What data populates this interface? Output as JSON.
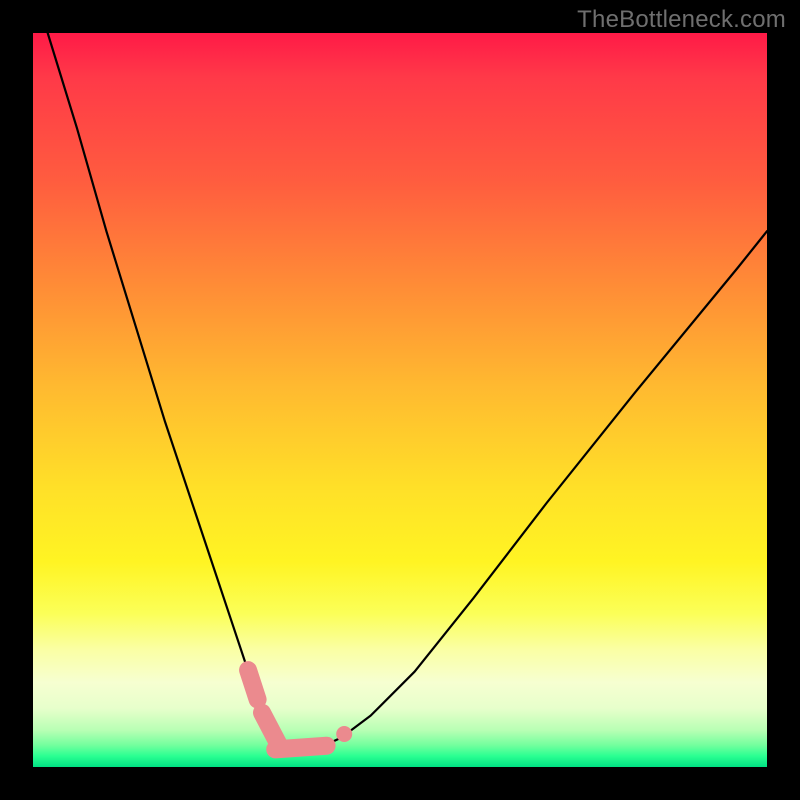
{
  "watermark": "TheBottleneck.com",
  "chart_data": {
    "type": "line",
    "title": "",
    "xlabel": "",
    "ylabel": "",
    "xlim": [
      0,
      100
    ],
    "ylim": [
      0,
      100
    ],
    "grid": false,
    "legend": false,
    "series": [
      {
        "name": "bottleneck-curve",
        "x": [
          2,
          6,
          10,
          14,
          18,
          22,
          25,
          27,
          29,
          30,
          31,
          32,
          33,
          34,
          35,
          36,
          37,
          39,
          42,
          46,
          52,
          60,
          70,
          82,
          96,
          100
        ],
        "y": [
          100,
          87,
          73,
          60,
          47,
          35,
          26,
          20,
          14,
          10,
          7,
          5,
          3.5,
          2.5,
          2,
          2,
          2.2,
          2.6,
          4,
          7,
          13,
          23,
          36,
          51,
          68,
          73
        ]
      }
    ],
    "highlight_segments": [
      {
        "name": "left-bead-run",
        "x": [
          29.5,
          33.5
        ],
        "y": [
          12.5,
          3.0
        ]
      },
      {
        "name": "bottom-bead-run",
        "x": [
          33.0,
          40.0
        ],
        "y": [
          2.3,
          2.8
        ]
      },
      {
        "name": "right-bead-dot",
        "x": [
          42.2
        ],
        "y": [
          4.3
        ]
      }
    ],
    "colors": {
      "curve": "#000000",
      "beads": "#eb8a8e"
    }
  }
}
